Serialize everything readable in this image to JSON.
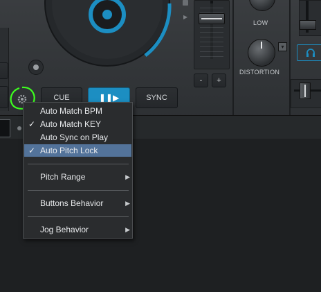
{
  "deck": {
    "knob_low_label": "LOW",
    "knob_distortion_label": "DISTORTION",
    "minus_label": "-",
    "plus_label": "+",
    "cue_label": "CUE",
    "play_label": "❚❚▶",
    "sync_label": "SYNC"
  },
  "menu": {
    "items": [
      {
        "label": "Auto Match BPM",
        "check": ""
      },
      {
        "label": "Auto Match KEY",
        "check": "✓"
      },
      {
        "label": "Auto Sync on Play",
        "check": ""
      },
      {
        "label": "Auto Pitch Lock",
        "check": "✓"
      },
      {
        "label": "Pitch Range",
        "arrow": "▶"
      },
      {
        "label": "Buttons Behavior",
        "arrow": "▶"
      },
      {
        "label": "Jog Behavior",
        "arrow": "▶"
      }
    ]
  },
  "colors": {
    "accent": "#1c8ec2",
    "highlight_circle": "#3dff1f",
    "menu_selected": "#53739a"
  }
}
